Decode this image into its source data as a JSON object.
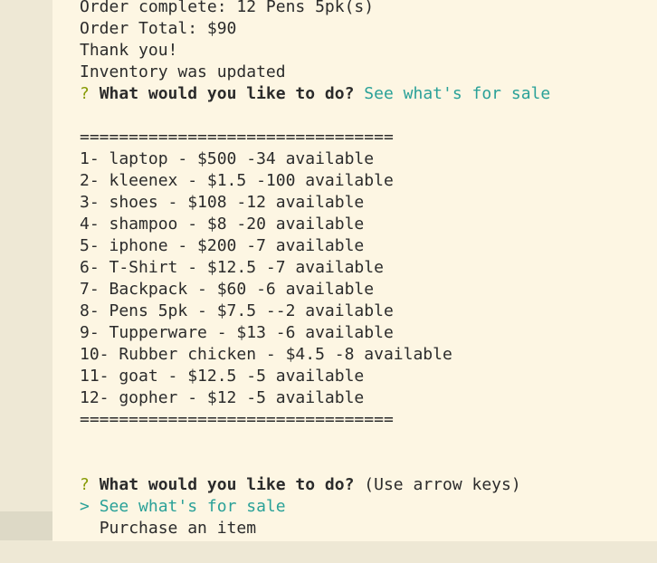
{
  "order": {
    "complete": "Order complete: 12 Pens 5pk(s)",
    "total": "Order Total: $90",
    "thanks": "Thank you!",
    "inventory": "Inventory was updated"
  },
  "prompt1": {
    "mark": "?",
    "question": "What would you like to do?",
    "answer": "See what's for sale"
  },
  "separator": "================================",
  "items": [
    "1- laptop - $500 -34 available",
    "2- kleenex - $1.5 -100 available",
    "3- shoes - $108 -12 available",
    "4- shampoo - $8 -20 available",
    "5- iphone - $200 -7 available",
    "6- T-Shirt - $12.5 -7 available",
    "7- Backpack - $60 -6 available",
    "8- Pens 5pk - $7.5 --2 available",
    "9- Tupperware - $13 -6 available",
    "10- Rubber chicken - $4.5 -8 available",
    "11- goat - $12.5 -5 available",
    "12- gopher - $12 -5 available"
  ],
  "prompt2": {
    "mark": "?",
    "question": "What would you like to do?",
    "hint": "(Use arrow keys)",
    "pointer": ">",
    "choices": [
      "See what's for sale",
      "Purchase an item"
    ]
  }
}
